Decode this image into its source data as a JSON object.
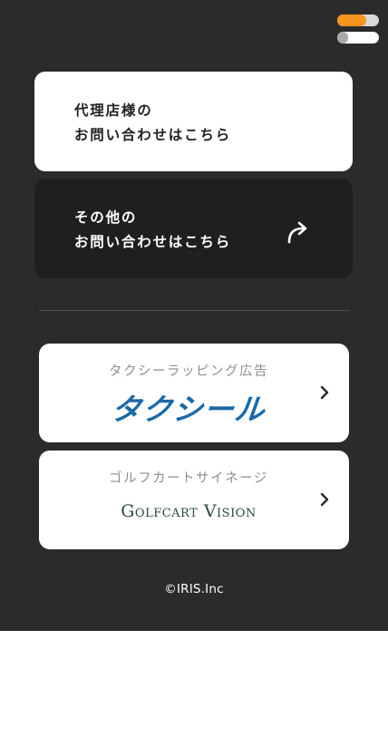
{
  "menu": {
    "toggle_icon": "menu-toggle-icon"
  },
  "contact": {
    "agency": {
      "line1": "代理店様の",
      "line2": "お問い合わせはこちら"
    },
    "other": {
      "line1": "その他の",
      "line2": "お問い合わせはこちら",
      "icon": "share-arrow-icon"
    }
  },
  "services": {
    "taxi": {
      "caption": "タクシーラッピング広告",
      "logo_text": "タクシール",
      "icon": "chevron-right-icon"
    },
    "golf": {
      "caption": "ゴルフカートサイネージ",
      "logo_text": "Golfcart Vision",
      "icon": "chevron-right-icon"
    }
  },
  "footer": {
    "copyright": "©IRIS.Inc"
  },
  "colors": {
    "panel_bg": "#2b2b2b",
    "dark_card": "#1f1f1f",
    "accent_orange": "#f7941d",
    "taxi_logo_blue": "#1a6aa8",
    "golf_logo_green": "#2c4a3c"
  }
}
